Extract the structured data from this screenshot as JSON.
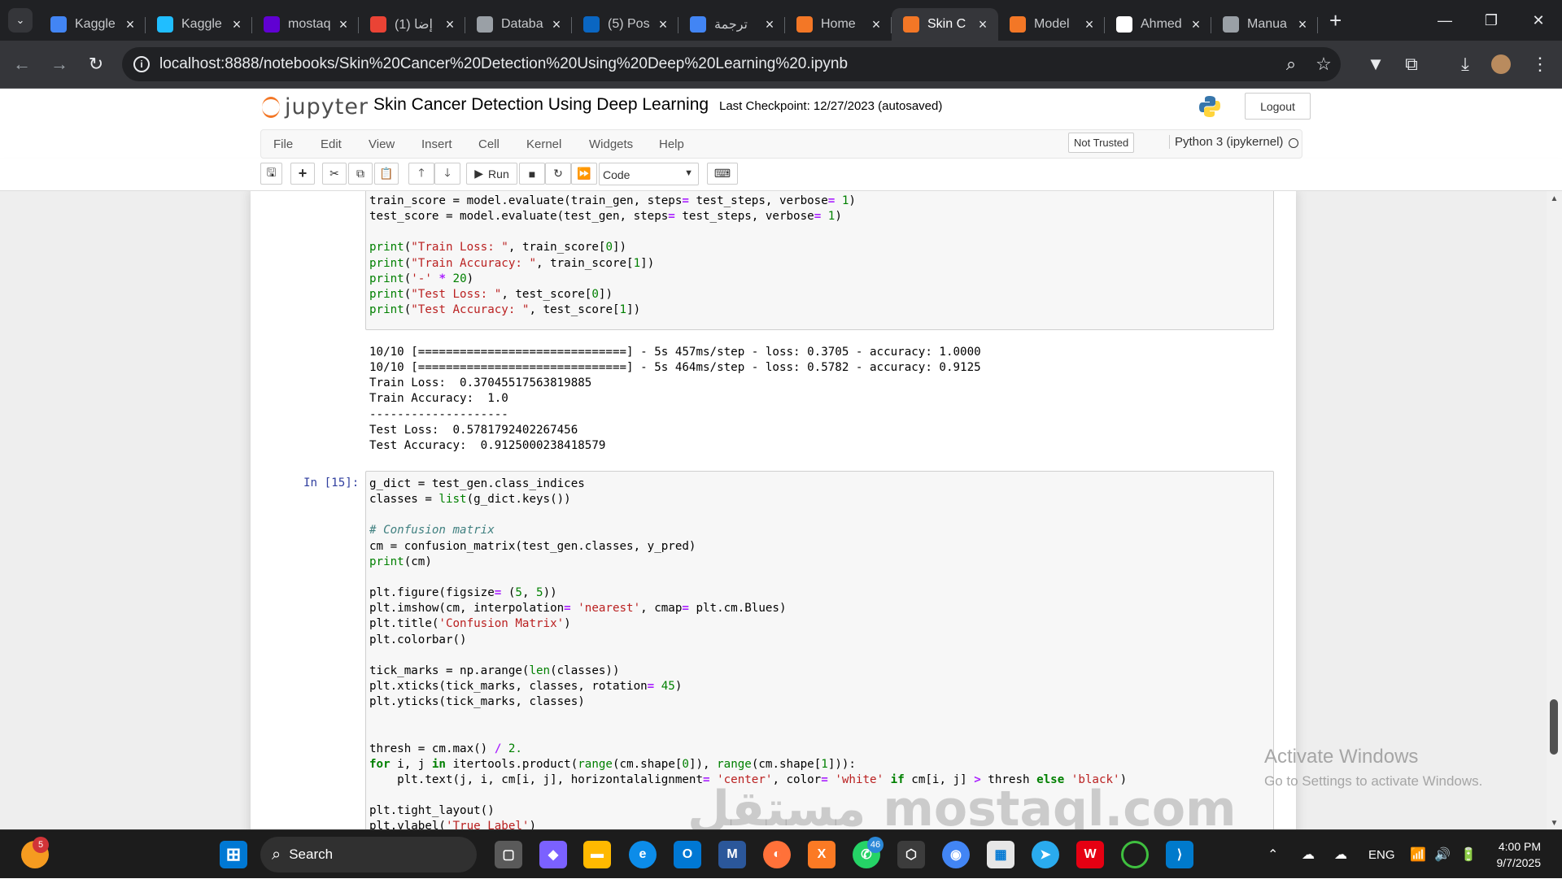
{
  "browser": {
    "tabs": [
      {
        "title": "Kaggle",
        "icon_color": "#4285f4",
        "icon": "docs-icon"
      },
      {
        "title": "Kaggle",
        "icon_color": "#20beff",
        "icon": "kaggle-icon"
      },
      {
        "title": "mostaq",
        "icon_color": "#6001d2",
        "icon": "yahoo-icon"
      },
      {
        "title": "(1) إضا",
        "icon_color": "#ea4335",
        "icon": "google-icon"
      },
      {
        "title": "Databa",
        "icon_color": "#9aa0a6",
        "icon": "database-icon"
      },
      {
        "title": "(5) Pos",
        "icon_color": "#0a66c2",
        "icon": "linkedin-icon"
      },
      {
        "title": "ترجمة",
        "icon_color": "#4285f4",
        "icon": "translate-icon"
      },
      {
        "title": "Home",
        "icon_color": "#f37726",
        "icon": "jupyter-icon"
      },
      {
        "title": "Skin C",
        "icon_color": "#f37726",
        "icon": "notebook-icon"
      },
      {
        "title": "Model",
        "icon_color": "#f37726",
        "icon": "notebook-icon"
      },
      {
        "title": "Ahmed",
        "icon_color": "#ffffff",
        "icon": "github-icon"
      },
      {
        "title": "Manua",
        "icon_color": "#9aa0a6",
        "icon": "globe-icon"
      }
    ],
    "active_tab_index": 8,
    "url": "localhost:8888/notebooks/Skin%20Cancer%20Detection%20Using%20Deep%20Learning%20.ipynb"
  },
  "jupyter": {
    "logo_text": "jupyter",
    "notebook_title": "Skin Cancer Detection Using Deep Learning",
    "checkpoint": "Last Checkpoint: 12/27/2023  (autosaved)",
    "logout_label": "Logout",
    "menu": [
      "File",
      "Edit",
      "View",
      "Insert",
      "Cell",
      "Kernel",
      "Widgets",
      "Help"
    ],
    "trust_label": "Not Trusted",
    "kernel_label": "Python 3 (ipykernel)",
    "run_label": "Run",
    "cell_type": "Code"
  },
  "cells": {
    "cell1_prompt": "",
    "cell2_prompt": "In [15]:",
    "output1": [
      "10/10 [==============================] - 5s 457ms/step - loss: 0.3705 - accuracy: 1.0000",
      "10/10 [==============================] - 5s 464ms/step - loss: 0.5782 - accuracy: 0.9125",
      "Train Loss:  0.37045517563819885",
      "Train Accuracy:  1.0",
      "--------------------",
      "Test Loss:  0.5781792402267456",
      "Test Accuracy:  0.9125000238418579"
    ]
  },
  "os": {
    "search_label": "Search",
    "notification_count": "5",
    "whatsapp_badge": "46",
    "language": "ENG",
    "time": "4:00 PM",
    "date": "9/7/2025",
    "activate_title": "Activate Windows",
    "activate_sub": "Go to Settings to activate Windows.",
    "watermark": "مستقل mostaql.com"
  }
}
